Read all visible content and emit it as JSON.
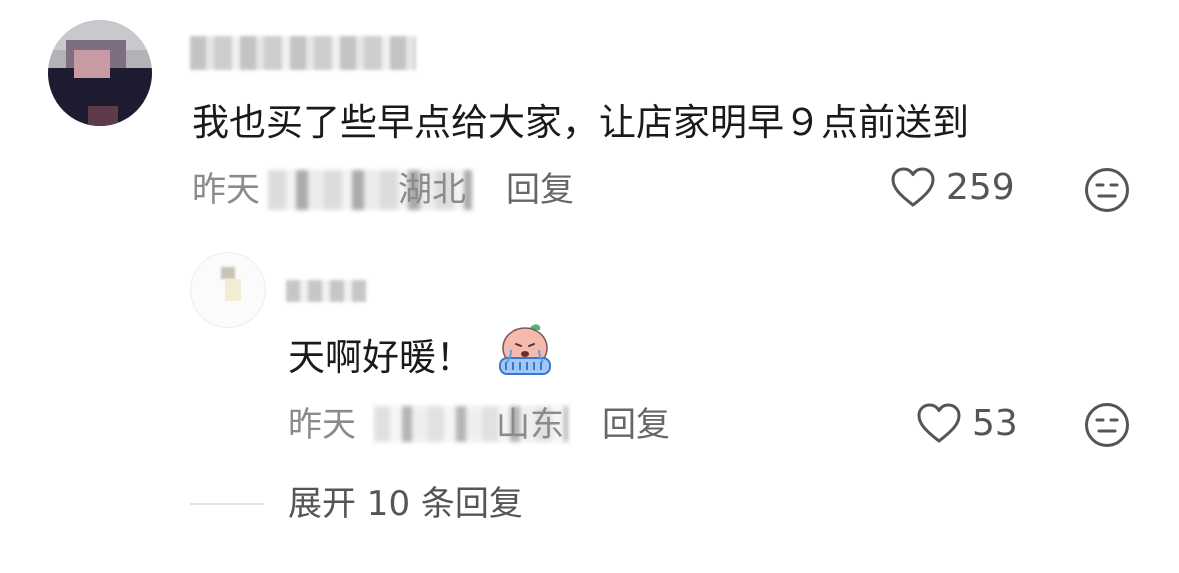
{
  "main_comment": {
    "avatar": "avatar (blurred)",
    "text": "我也买了些早点给大家，让店家明早９点前送到",
    "time": "昨天",
    "location": "湖北",
    "reply_label": "回复",
    "like_count": "259",
    "icons": {
      "like": "heart-outline-icon",
      "react": "neutral-face-icon"
    }
  },
  "reply": {
    "text": "天啊好暖！",
    "sticker": "crying-sticker",
    "time": "昨天",
    "location": "山东",
    "reply_label": "回复",
    "like_count": "53",
    "icons": {
      "like": "heart-outline-icon",
      "react": "neutral-face-icon"
    }
  },
  "expand_label": "展开 10 条回复",
  "colors": {
    "text": "#1a1a1a",
    "meta": "#8b8b8b",
    "action": "#555555"
  }
}
